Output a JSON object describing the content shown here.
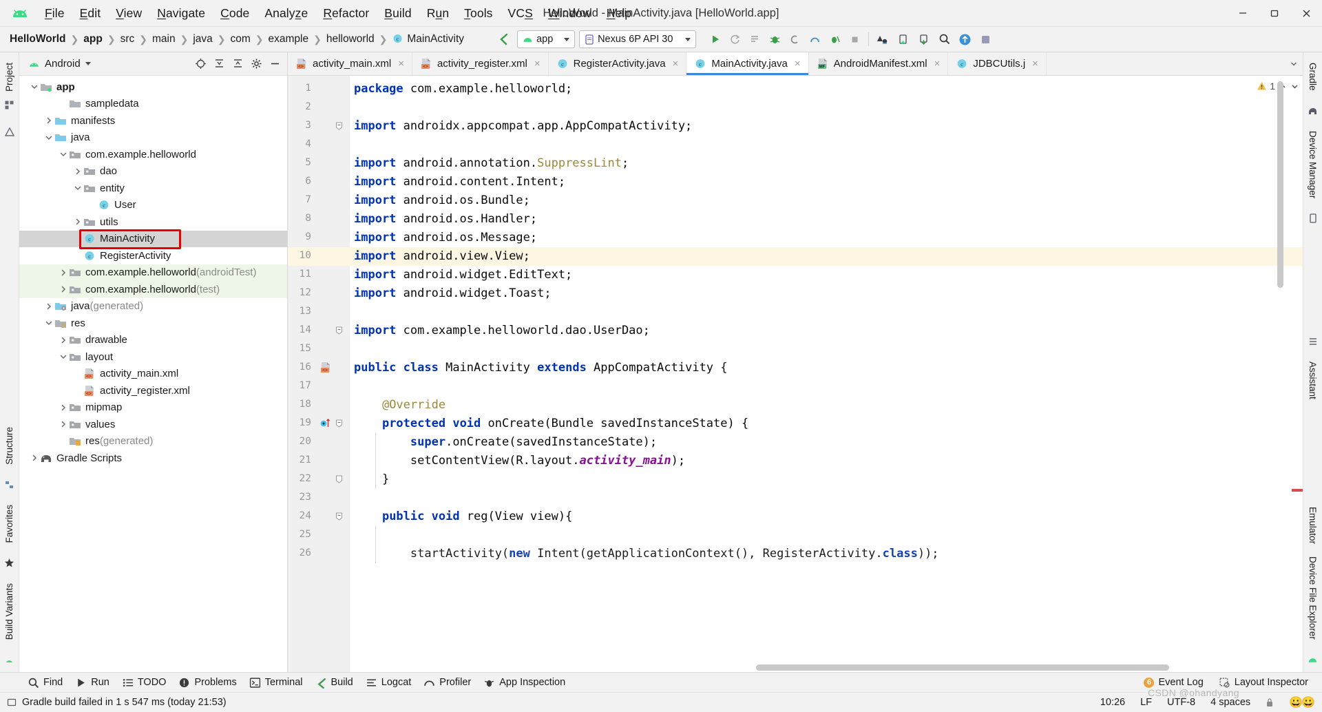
{
  "window": {
    "title": "HelloWorld - MainActivity.java [HelloWorld.app]",
    "minimize_label": "minimize-icon",
    "restore_label": "restore-icon",
    "close_label": "close-icon"
  },
  "menu": {
    "items": [
      {
        "label": "File",
        "mnemonic": "F"
      },
      {
        "label": "Edit",
        "mnemonic": "E"
      },
      {
        "label": "View",
        "mnemonic": "V"
      },
      {
        "label": "Navigate",
        "mnemonic": "N"
      },
      {
        "label": "Code",
        "mnemonic": "C"
      },
      {
        "label": "Analyze",
        "mnemonic": "z"
      },
      {
        "label": "Refactor",
        "mnemonic": "R"
      },
      {
        "label": "Build",
        "mnemonic": "B"
      },
      {
        "label": "Run",
        "mnemonic": "u"
      },
      {
        "label": "Tools",
        "mnemonic": "T"
      },
      {
        "label": "VCS",
        "mnemonic": "S"
      },
      {
        "label": "Window",
        "mnemonic": "W"
      },
      {
        "label": "Help",
        "mnemonic": "H"
      }
    ]
  },
  "breadcrumb": {
    "items": [
      "HelloWorld",
      "app",
      "src",
      "main",
      "java",
      "com",
      "example",
      "helloworld",
      "MainActivity"
    ],
    "last_icon": "java-class-icon"
  },
  "toolbar": {
    "sync_icon": "gradle-sync-icon",
    "module_selector": "app",
    "device_selector": "Nexus 6P API 30",
    "buttons": [
      {
        "name": "run-button",
        "glyph": "run"
      },
      {
        "name": "rerun-button",
        "glyph": "rerun"
      },
      {
        "name": "apply-changes-button",
        "glyph": "apply-changes"
      },
      {
        "name": "debug-button",
        "glyph": "debug"
      },
      {
        "name": "attach-debugger-button",
        "glyph": "attach"
      },
      {
        "name": "profile-button",
        "glyph": "profile"
      },
      {
        "name": "run-coverage-button",
        "glyph": "coverage"
      },
      {
        "name": "stop-button",
        "glyph": "stop"
      },
      {
        "name": "sdk-manager-button",
        "glyph": "sdk"
      },
      {
        "name": "avd-manager-button",
        "glyph": "avd"
      },
      {
        "name": "device-file-explorer-button",
        "glyph": "device-files"
      },
      {
        "name": "search-everywhere-button",
        "glyph": "search"
      },
      {
        "name": "vcs-update-button",
        "glyph": "update"
      },
      {
        "name": "profiler-button",
        "glyph": "profiler"
      }
    ]
  },
  "project_panel": {
    "title": "Android",
    "actions": [
      "locate-icon",
      "expand-all-icon",
      "collapse-all-icon",
      "settings-icon",
      "hide-icon"
    ],
    "tree": [
      {
        "depth": 0,
        "label": "app",
        "icon": "module-folder",
        "arrow": "down",
        "bold": true
      },
      {
        "depth": 2,
        "label": "sampledata",
        "icon": "folder-gray",
        "arrow": "none"
      },
      {
        "depth": 1,
        "label": "manifests",
        "icon": "folder-blue",
        "arrow": "right"
      },
      {
        "depth": 1,
        "label": "java",
        "icon": "folder-blue",
        "arrow": "down"
      },
      {
        "depth": 2,
        "label": "com.example.helloworld",
        "icon": "package",
        "arrow": "down"
      },
      {
        "depth": 3,
        "label": "dao",
        "icon": "package",
        "arrow": "right"
      },
      {
        "depth": 3,
        "label": "entity",
        "icon": "package",
        "arrow": "down"
      },
      {
        "depth": 4,
        "label": "User",
        "icon": "java-class",
        "arrow": "none"
      },
      {
        "depth": 3,
        "label": "utils",
        "icon": "package",
        "arrow": "right"
      },
      {
        "depth": 3,
        "label": "MainActivity",
        "icon": "java-class",
        "arrow": "none",
        "selected": true,
        "annotated": true
      },
      {
        "depth": 3,
        "label": "RegisterActivity",
        "icon": "java-class",
        "arrow": "none"
      },
      {
        "depth": 2,
        "label": "com.example.helloworld",
        "suffix": " (androidTest)",
        "icon": "package",
        "arrow": "right",
        "testsrc": true
      },
      {
        "depth": 2,
        "label": "com.example.helloworld",
        "suffix": " (test)",
        "icon": "package",
        "arrow": "right",
        "testsrc": true
      },
      {
        "depth": 1,
        "label": "java",
        "suffix": " (generated)",
        "icon": "folder-generated",
        "arrow": "right"
      },
      {
        "depth": 1,
        "label": "res",
        "icon": "folder-res",
        "arrow": "down"
      },
      {
        "depth": 2,
        "label": "drawable",
        "icon": "package",
        "arrow": "right"
      },
      {
        "depth": 2,
        "label": "layout",
        "icon": "package",
        "arrow": "down"
      },
      {
        "depth": 3,
        "label": "activity_main.xml",
        "icon": "layout-xml",
        "arrow": "none"
      },
      {
        "depth": 3,
        "label": "activity_register.xml",
        "icon": "layout-xml",
        "arrow": "none"
      },
      {
        "depth": 2,
        "label": "mipmap",
        "icon": "package",
        "arrow": "right"
      },
      {
        "depth": 2,
        "label": "values",
        "icon": "package",
        "arrow": "right"
      },
      {
        "depth": 2,
        "label": "res",
        "suffix": " (generated)",
        "icon": "folder-res",
        "arrow": "none"
      },
      {
        "depth": 0,
        "label": "Gradle Scripts",
        "icon": "gradle",
        "arrow": "right"
      }
    ]
  },
  "editor": {
    "tabs": [
      {
        "label": "activity_main.xml",
        "icon": "layout-xml",
        "active": false
      },
      {
        "label": "activity_register.xml",
        "icon": "layout-xml",
        "active": false
      },
      {
        "label": "RegisterActivity.java",
        "icon": "java-class",
        "active": false
      },
      {
        "label": "MainActivity.java",
        "icon": "java-class",
        "active": true
      },
      {
        "label": "AndroidManifest.xml",
        "icon": "manifest-xml",
        "active": false
      },
      {
        "label": "JDBCUtils.j",
        "icon": "java-class",
        "active": false
      }
    ],
    "warning_count": "1",
    "warning_icon": "warning-triangle-icon",
    "caret_line": 10,
    "lines": [
      {
        "n": 1,
        "tokens": [
          {
            "t": "package",
            "c": "kw"
          },
          {
            "t": " com.example.helloworld;"
          }
        ]
      },
      {
        "n": 2,
        "tokens": []
      },
      {
        "n": 3,
        "tokens": [
          {
            "t": "import",
            "c": "kw"
          },
          {
            "t": " androidx.appcompat.app.AppCompatActivity;"
          }
        ],
        "fold": "collapse"
      },
      {
        "n": 4,
        "tokens": []
      },
      {
        "n": 5,
        "tokens": [
          {
            "t": "import",
            "c": "kw"
          },
          {
            "t": " android.annotation."
          },
          {
            "t": "SuppressLint",
            "c": "anno"
          },
          {
            "t": ";"
          }
        ]
      },
      {
        "n": 6,
        "tokens": [
          {
            "t": "import",
            "c": "kw"
          },
          {
            "t": " android.content.Intent;"
          }
        ]
      },
      {
        "n": 7,
        "tokens": [
          {
            "t": "import",
            "c": "kw"
          },
          {
            "t": " android.os.Bundle;"
          }
        ]
      },
      {
        "n": 8,
        "tokens": [
          {
            "t": "import",
            "c": "kw"
          },
          {
            "t": " android.os.Handler;"
          }
        ]
      },
      {
        "n": 9,
        "tokens": [
          {
            "t": "import",
            "c": "kw"
          },
          {
            "t": " android.os.Message;"
          }
        ]
      },
      {
        "n": 10,
        "tokens": [
          {
            "t": "import",
            "c": "kw"
          },
          {
            "t": " android.view.View;"
          }
        ],
        "highlight": true
      },
      {
        "n": 11,
        "tokens": [
          {
            "t": "import",
            "c": "kw"
          },
          {
            "t": " android.widget.EditText;"
          }
        ]
      },
      {
        "n": 12,
        "tokens": [
          {
            "t": "import",
            "c": "kw"
          },
          {
            "t": " android.widget.Toast;"
          }
        ]
      },
      {
        "n": 13,
        "tokens": []
      },
      {
        "n": 14,
        "tokens": [
          {
            "t": "import",
            "c": "kw"
          },
          {
            "t": " com.example.helloworld.dao.UserDao;"
          }
        ],
        "fold": "collapse"
      },
      {
        "n": 15,
        "tokens": []
      },
      {
        "n": 16,
        "tokens": [
          {
            "t": "public",
            "c": "kw"
          },
          {
            "t": " "
          },
          {
            "t": "class",
            "c": "kw"
          },
          {
            "t": " MainActivity "
          },
          {
            "t": "extends",
            "c": "kw"
          },
          {
            "t": " AppCompatActivity {"
          }
        ],
        "gutter_icon": "layout-xml"
      },
      {
        "n": 17,
        "tokens": []
      },
      {
        "n": 18,
        "tokens": [
          {
            "t": "    "
          },
          {
            "t": "@Override",
            "c": "anno"
          }
        ]
      },
      {
        "n": 19,
        "tokens": [
          {
            "t": "    "
          },
          {
            "t": "protected",
            "c": "kw"
          },
          {
            "t": " "
          },
          {
            "t": "void",
            "c": "kw"
          },
          {
            "t": " onCreate(Bundle savedInstanceState) {"
          }
        ],
        "gutter_icon": "override-method",
        "fold": "collapse"
      },
      {
        "n": 20,
        "tokens": [
          {
            "t": "        "
          },
          {
            "t": "super",
            "c": "kw"
          },
          {
            "t": ".onCreate(savedInstanceState);"
          }
        ]
      },
      {
        "n": 21,
        "tokens": [
          {
            "t": "        setContentView(R.layout."
          },
          {
            "t": "activity_main",
            "c": "field"
          },
          {
            "t": ");"
          }
        ]
      },
      {
        "n": 22,
        "tokens": [
          {
            "t": "    }"
          }
        ],
        "fold": "end"
      },
      {
        "n": 23,
        "tokens": []
      },
      {
        "n": 24,
        "tokens": [
          {
            "t": "    "
          },
          {
            "t": "public",
            "c": "kw"
          },
          {
            "t": " "
          },
          {
            "t": "void",
            "c": "kw"
          },
          {
            "t": " reg(View view){"
          }
        ],
        "fold": "collapse"
      },
      {
        "n": 25,
        "tokens": []
      },
      {
        "n": 26,
        "tokens": [
          {
            "t": "        startActivity("
          },
          {
            "t": "new",
            "c": "kw"
          },
          {
            "t": " Intent(getApplicationContext(), RegisterActivity."
          },
          {
            "t": "class",
            "c": "kw"
          },
          {
            "t": "));"
          }
        ],
        "clipped": true
      }
    ]
  },
  "left_rail": {
    "top": [
      "Project"
    ],
    "bottom": [
      "Structure",
      "Favorites",
      "Build Variants"
    ],
    "icons": [
      "resource-manager-icon",
      "structure-icon",
      "favorites-star-icon",
      "build-variants-icon"
    ]
  },
  "right_rail": {
    "items": [
      "Gradle",
      "Device Manager",
      "Assistant",
      "Emulator",
      "Device File Explorer"
    ]
  },
  "tool_window_bar": {
    "items": [
      {
        "label": "Find",
        "icon": "search-icon"
      },
      {
        "label": "Run",
        "icon": "run-icon"
      },
      {
        "label": "TODO",
        "icon": "todo-icon"
      },
      {
        "label": "Problems",
        "icon": "problems-icon"
      },
      {
        "label": "Terminal",
        "icon": "terminal-icon"
      },
      {
        "label": "Build",
        "icon": "build-hammer-icon"
      },
      {
        "label": "Logcat",
        "icon": "logcat-icon"
      },
      {
        "label": "Profiler",
        "icon": "profiler-icon"
      },
      {
        "label": "App Inspection",
        "icon": "app-inspection-icon"
      }
    ],
    "right_items": [
      {
        "label": "Event Log",
        "icon": "event-log-icon",
        "badge": "6"
      },
      {
        "label": "Layout Inspector",
        "icon": "layout-inspector-icon"
      }
    ]
  },
  "status_bar": {
    "message": "Gradle build failed in 1 s 547 ms (today 21:53)",
    "message_icon": "build-status-icon",
    "position": "10:26",
    "line_separator": "LF",
    "encoding": "UTF-8",
    "indent": "4 spaces",
    "watermark": "CSDN @ohandyang"
  },
  "colors": {
    "accent_blue": "#3f85d9",
    "keyword": "#0033b3",
    "annotation": "#9a8a3a",
    "field": "#871094",
    "annotation_box": "#e60000",
    "android_green": "#3ddc84",
    "selection_gray": "#d4d4d4",
    "test_source_green": "#eef7e7",
    "caret_line": "#fdf6e3"
  }
}
